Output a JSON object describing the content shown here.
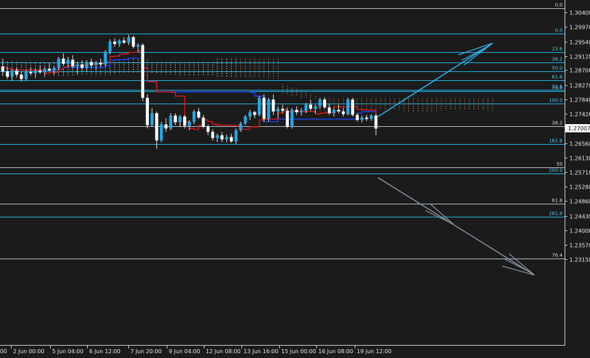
{
  "chart_data": {
    "type": "candlestick",
    "symbol_note": "",
    "y_axis_ticks": [
      1.30408,
      1.29978,
      1.29548,
      1.29128,
      1.28708,
      1.28278,
      1.27848,
      1.27428,
      1.26998,
      1.26568,
      1.26138,
      1.25718,
      1.25288,
      1.24868,
      1.24438,
      1.24008,
      1.23578,
      1.23158
    ],
    "y_axis_labels": [
      "1.30408",
      "1.29978",
      "1.29548",
      "1.29128",
      "1.28708",
      "1.28278",
      "1.27848",
      "1.27428",
      "1.27007",
      "1.26568",
      "1.26138",
      "1.25718",
      "1.25288",
      "1.24868",
      "1.24438",
      "1.24008",
      "1.23578",
      "1.23158"
    ],
    "current_price_label": "1.27007",
    "ylim": [
      1.23,
      1.306
    ],
    "x_axis_labels": [
      "2 Jun 00:00",
      "5 Jun 04:00",
      "6 Jun 12:00",
      "7 Jun 20:00",
      "9 Jun 04:00",
      "12 Jun 08:00",
      "13 Jun 16:00",
      "15 Jun 00:00",
      "16 Jun 08:00",
      "19 Jun 12:00"
    ],
    "x_axis_left_fragment": "00",
    "fib_levels": [
      {
        "label": "0.0",
        "price": 1.3052
      },
      {
        "label": "0.0",
        "price": 1.2978
      },
      {
        "label": "23.6",
        "price": 1.2925
      },
      {
        "label": "38.2",
        "price": 1.2893
      },
      {
        "label": "50.0",
        "price": 1.2867
      },
      {
        "label": "61.8",
        "price": 1.2841
      },
      {
        "label": "23.6",
        "price": 1.2814
      },
      {
        "label": "76.4",
        "price": 1.2809
      },
      {
        "label": "100.0",
        "price": 1.2773
      },
      {
        "label": "38.2",
        "price": 1.2706
      },
      {
        "label": "161.8",
        "price": 1.2655
      },
      {
        "label": "50",
        "price": 1.2586
      },
      {
        "label": "200.0",
        "price": 1.2568
      },
      {
        "label": "61.8",
        "price": 1.2479
      },
      {
        "label": "261.8",
        "price": 1.2441
      },
      {
        "label": "76.4",
        "price": 1.2319
      }
    ],
    "candles": [
      [
        1.2882,
        1.2905,
        1.2855,
        1.2868
      ],
      [
        1.2868,
        1.288,
        1.2845,
        1.2852
      ],
      [
        1.2852,
        1.2875,
        1.284,
        1.287
      ],
      [
        1.287,
        1.2878,
        1.285,
        1.2858
      ],
      [
        1.2858,
        1.2868,
        1.2838,
        1.2845
      ],
      [
        1.2845,
        1.2872,
        1.284,
        1.2866
      ],
      [
        1.2866,
        1.288,
        1.2855,
        1.2862
      ],
      [
        1.2862,
        1.2875,
        1.2848,
        1.287
      ],
      [
        1.287,
        1.2885,
        1.286,
        1.2865
      ],
      [
        1.2865,
        1.288,
        1.2852,
        1.2875
      ],
      [
        1.2875,
        1.2892,
        1.2868,
        1.287
      ],
      [
        1.287,
        1.2882,
        1.2858,
        1.2878
      ],
      [
        1.2878,
        1.291,
        1.2872,
        1.2905
      ],
      [
        1.2905,
        1.292,
        1.2885,
        1.289
      ],
      [
        1.289,
        1.291,
        1.288,
        1.2902
      ],
      [
        1.2902,
        1.2915,
        1.2875,
        1.2882
      ],
      [
        1.2882,
        1.2895,
        1.286,
        1.2888
      ],
      [
        1.2888,
        1.29,
        1.287,
        1.2878
      ],
      [
        1.2878,
        1.29,
        1.287,
        1.2895
      ],
      [
        1.2895,
        1.2905,
        1.2878,
        1.2885
      ],
      [
        1.2885,
        1.2898,
        1.2872,
        1.2892
      ],
      [
        1.2892,
        1.2905,
        1.288,
        1.2888
      ],
      [
        1.2888,
        1.293,
        1.2882,
        1.2925
      ],
      [
        1.2925,
        1.2962,
        1.2918,
        1.2955
      ],
      [
        1.2955,
        1.2965,
        1.294,
        1.2948
      ],
      [
        1.2948,
        1.2962,
        1.294,
        1.2958
      ],
      [
        1.2958,
        1.2968,
        1.2948,
        1.2952
      ],
      [
        1.2952,
        1.2975,
        1.2945,
        1.2968
      ],
      [
        1.2968,
        1.2972,
        1.2935,
        1.294
      ],
      [
        1.294,
        1.295,
        1.2925,
        1.2945
      ],
      [
        1.2945,
        1.295,
        1.278,
        1.279
      ],
      [
        1.279,
        1.28,
        1.27,
        1.271
      ],
      [
        1.271,
        1.276,
        1.2705,
        1.2745
      ],
      [
        1.2745,
        1.275,
        1.264,
        1.2665
      ],
      [
        1.2665,
        1.272,
        1.266,
        1.2712
      ],
      [
        1.2712,
        1.273,
        1.269,
        1.27
      ],
      [
        1.27,
        1.2745,
        1.2695,
        1.2738
      ],
      [
        1.2738,
        1.2745,
        1.271,
        1.2718
      ],
      [
        1.2718,
        1.274,
        1.2705,
        1.2735
      ],
      [
        1.2735,
        1.274,
        1.27,
        1.2708
      ],
      [
        1.2708,
        1.2725,
        1.2695,
        1.272
      ],
      [
        1.272,
        1.2755,
        1.2712,
        1.275
      ],
      [
        1.275,
        1.276,
        1.2728,
        1.2732
      ],
      [
        1.2732,
        1.274,
        1.27,
        1.2705
      ],
      [
        1.2705,
        1.2712,
        1.268,
        1.269
      ],
      [
        1.269,
        1.2698,
        1.2665,
        1.2672
      ],
      [
        1.2672,
        1.2685,
        1.266,
        1.268
      ],
      [
        1.268,
        1.269,
        1.266,
        1.2668
      ],
      [
        1.2668,
        1.2682,
        1.266,
        1.2675
      ],
      [
        1.2675,
        1.2685,
        1.2658,
        1.2662
      ],
      [
        1.2662,
        1.27,
        1.2655,
        1.2695
      ],
      [
        1.2695,
        1.272,
        1.269,
        1.2715
      ],
      [
        1.2715,
        1.274,
        1.271,
        1.2735
      ],
      [
        1.2735,
        1.2755,
        1.2725,
        1.2748
      ],
      [
        1.2748,
        1.2752,
        1.273,
        1.274
      ],
      [
        1.274,
        1.2795,
        1.2735,
        1.279
      ],
      [
        1.279,
        1.28,
        1.272,
        1.2728
      ],
      [
        1.2728,
        1.279,
        1.272,
        1.2785
      ],
      [
        1.2785,
        1.28,
        1.274,
        1.275
      ],
      [
        1.275,
        1.2765,
        1.273,
        1.2758
      ],
      [
        1.2758,
        1.277,
        1.2745,
        1.2752
      ],
      [
        1.2752,
        1.2762,
        1.27,
        1.2705
      ],
      [
        1.2705,
        1.276,
        1.27,
        1.2755
      ],
      [
        1.2755,
        1.2765,
        1.274,
        1.2748
      ],
      [
        1.2748,
        1.276,
        1.2738,
        1.2752
      ],
      [
        1.2752,
        1.2775,
        1.2745,
        1.277
      ],
      [
        1.277,
        1.2785,
        1.2752,
        1.2758
      ],
      [
        1.2758,
        1.277,
        1.2745,
        1.2765
      ],
      [
        1.2765,
        1.279,
        1.2758,
        1.2785
      ],
      [
        1.2785,
        1.2792,
        1.2758,
        1.2762
      ],
      [
        1.2762,
        1.2772,
        1.274,
        1.2745
      ],
      [
        1.2745,
        1.276,
        1.2735,
        1.2755
      ],
      [
        1.2755,
        1.277,
        1.2745,
        1.275
      ],
      [
        1.275,
        1.276,
        1.2735,
        1.2742
      ],
      [
        1.2742,
        1.279,
        1.2738,
        1.2785
      ],
      [
        1.2785,
        1.279,
        1.2735,
        1.274
      ],
      [
        1.274,
        1.2745,
        1.272,
        1.2725
      ],
      [
        1.2725,
        1.2738,
        1.2718,
        1.2732
      ],
      [
        1.2732,
        1.274,
        1.2722,
        1.2728
      ],
      [
        1.2728,
        1.2742,
        1.2722,
        1.2738
      ],
      [
        1.2738,
        1.2742,
        1.268,
        1.27
      ]
    ]
  }
}
